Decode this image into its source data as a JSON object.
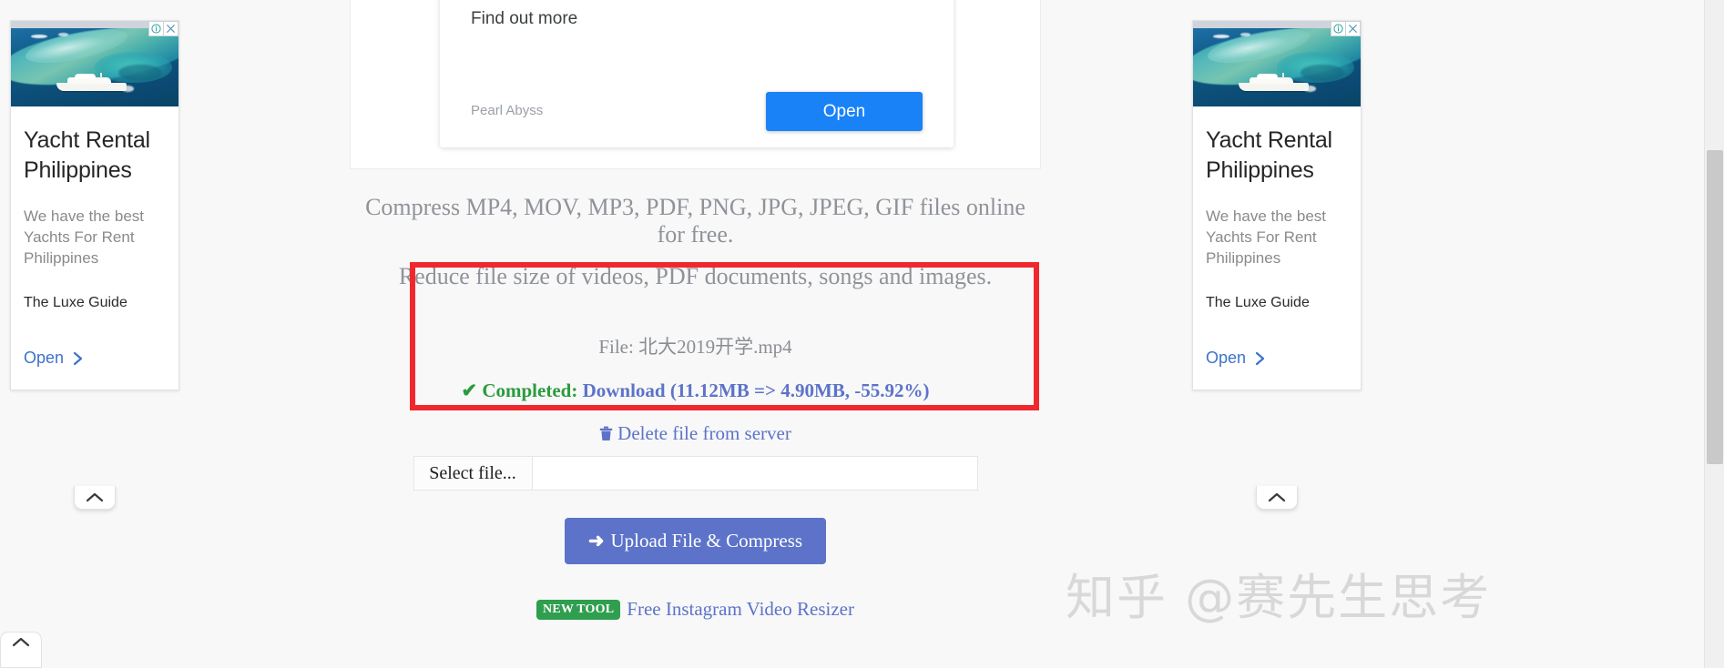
{
  "promo": {
    "title": "Find out more",
    "advertiser": "Pearl Abyss",
    "open_label": "Open"
  },
  "taglines": {
    "line1": "Compress MP4, MOV, MP3, PDF, PNG, JPG, JPEG, GIF files online for free.",
    "line2": "Reduce file size of videos, PDF documents, songs and images."
  },
  "result": {
    "file_label": "File: 北大2019开学.mp4",
    "check_icon": "✔",
    "status_label": "Completed:",
    "download_label": "Download (11.12MB => 4.90MB, -55.92%)",
    "delete_icon": "🗑",
    "delete_label": "Delete file from server",
    "status_color": "#2b9b3d",
    "link_color": "#5c73c9",
    "highlight_color": "#f0282d"
  },
  "upload": {
    "select_file_label": "Select file...",
    "file_value": "",
    "button_arrow": "➜",
    "button_label": "Upload File & Compress"
  },
  "newtool": {
    "badge": "NEW TOOL",
    "link_label": "Free Instagram Video Resizer",
    "badge_color": "#2f9e4f"
  },
  "ads": {
    "left": {
      "headline": "Yacht Rental Philippines",
      "description": "We have the best Yachts For Rent Philippines",
      "advertiser": "The Luxe Guide",
      "cta_label": "Open"
    },
    "right": {
      "headline": "Yacht Rental Philippines",
      "description": "We have the best Yachts For Rent Philippines",
      "advertiser": "The Luxe Guide",
      "cta_label": "Open"
    }
  },
  "watermark": {
    "text": "知乎 @赛先生思考"
  }
}
